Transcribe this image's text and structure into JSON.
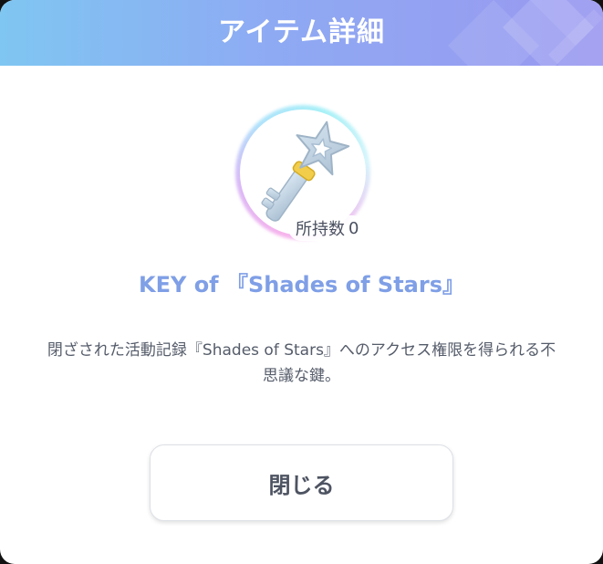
{
  "dialog": {
    "title": "アイテム詳細",
    "header_colors": [
      "#7fc6f2",
      "#9a98f0"
    ],
    "item": {
      "icon": "star-key-icon",
      "owned_label": "所持数",
      "owned_count": "0",
      "name": "KEY of 『Shades of Stars』",
      "name_color": "#7f9fe6",
      "description_line1": "閉ざされた活動記録『Shades of Stars』へのアクセス権限を得られる不",
      "description_line2": "思議な鍵。"
    },
    "close_button": {
      "label": "閉じる"
    }
  }
}
